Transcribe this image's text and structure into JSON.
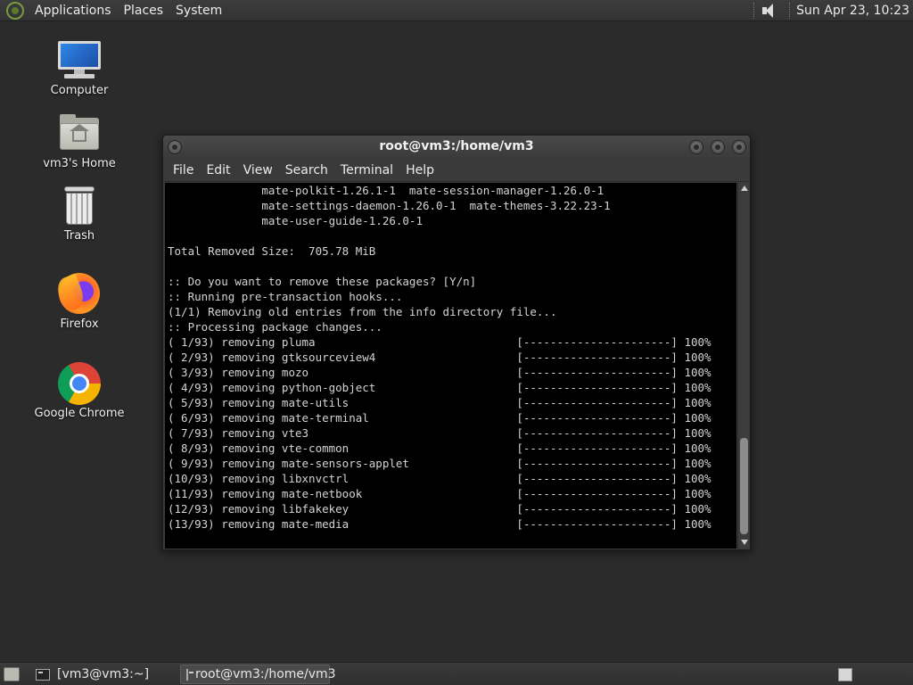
{
  "top_panel": {
    "menus": [
      "Applications",
      "Places",
      "System"
    ],
    "clock": "Sun Apr 23, 10:23"
  },
  "desktop": {
    "icons": [
      {
        "label": "Computer",
        "icon": "computer-icon"
      },
      {
        "label": "vm3's Home",
        "icon": "home-folder-icon"
      },
      {
        "label": "Trash",
        "icon": "trash-icon"
      },
      {
        "label": "Firefox",
        "icon": "firefox-icon"
      },
      {
        "label": "Google Chrome",
        "icon": "chrome-icon"
      }
    ]
  },
  "terminal": {
    "title": "root@vm3:/home/vm3",
    "menus": [
      "File",
      "Edit",
      "View",
      "Search",
      "Terminal",
      "Help"
    ],
    "lines": [
      "              mate-polkit-1.26.1-1  mate-session-manager-1.26.0-1",
      "              mate-settings-daemon-1.26.0-1  mate-themes-3.22.23-1",
      "              mate-user-guide-1.26.0-1",
      "",
      "Total Removed Size:  705.78 MiB",
      "",
      ":: Do you want to remove these packages? [Y/n]",
      ":: Running pre-transaction hooks...",
      "(1/1) Removing old entries from the info directory file...",
      ":: Processing package changes...",
      "( 1/93) removing pluma                              [----------------------] 100%",
      "( 2/93) removing gtksourceview4                     [----------------------] 100%",
      "( 3/93) removing mozo                               [----------------------] 100%",
      "( 4/93) removing python-gobject                     [----------------------] 100%",
      "( 5/93) removing mate-utils                         [----------------------] 100%",
      "( 6/93) removing mate-terminal                      [----------------------] 100%",
      "( 7/93) removing vte3                               [----------------------] 100%",
      "( 8/93) removing vte-common                         [----------------------] 100%",
      "( 9/93) removing mate-sensors-applet                [----------------------] 100%",
      "(10/93) removing libxnvctrl                         [----------------------] 100%",
      "(11/93) removing mate-netbook                       [----------------------] 100%",
      "(12/93) removing libfakekey                         [----------------------] 100%",
      "(13/93) removing mate-media                         [----------------------] 100%"
    ]
  },
  "taskbar": {
    "tasks": [
      "[vm3@vm3:~]",
      "root@vm3:/home/vm3"
    ]
  }
}
